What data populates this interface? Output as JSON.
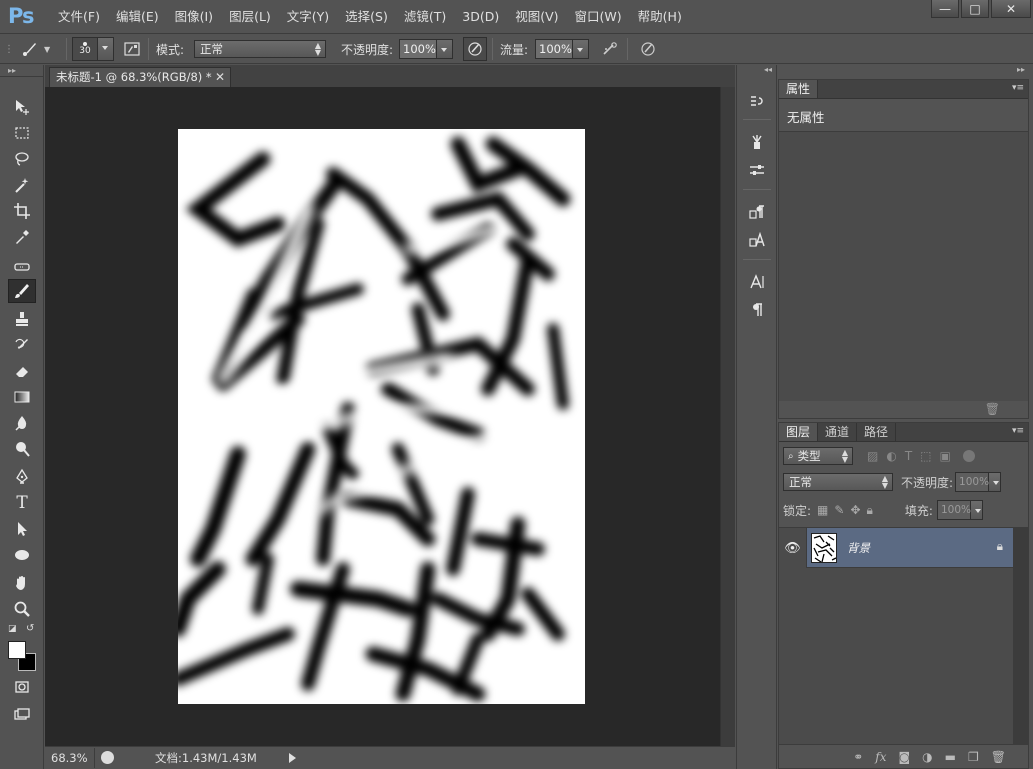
{
  "app": {
    "logo": "Ps",
    "menu": [
      "文件(F)",
      "编辑(E)",
      "图像(I)",
      "图层(L)",
      "文字(Y)",
      "选择(S)",
      "滤镜(T)",
      "3D(D)",
      "视图(V)",
      "窗口(W)",
      "帮助(H)"
    ],
    "window_controls": {
      "minimize": "—",
      "maximize": "□",
      "close": "✕"
    }
  },
  "options_bar": {
    "brush_size": "30",
    "mode_label": "模式:",
    "mode_value": "正常",
    "opacity_label": "不透明度:",
    "opacity_value": "100%",
    "flow_label": "流量:",
    "flow_value": "100%"
  },
  "document": {
    "tab_title": "未标题-1 @ 68.3%(RGB/8) *",
    "tab_close": "✕",
    "zoom": "68.3%",
    "doc_info": "文档:1.43M/1.43M"
  },
  "properties_panel": {
    "tab": "属性",
    "content": "无属性"
  },
  "layers_panel": {
    "tabs": [
      "图层",
      "通道",
      "路径"
    ],
    "filter_type": "类型",
    "blend_mode": "正常",
    "opacity_label": "不透明度:",
    "opacity_value": "100%",
    "lock_label": "锁定:",
    "fill_label": "填充:",
    "fill_value": "100%",
    "layers": [
      {
        "name": "背景",
        "visible": true,
        "locked": true
      }
    ]
  },
  "colors": {
    "accent_logo": "#7cb7ea",
    "selected_layer": "#5b6a83",
    "foreground": "#ffffff",
    "background": "#000000"
  }
}
